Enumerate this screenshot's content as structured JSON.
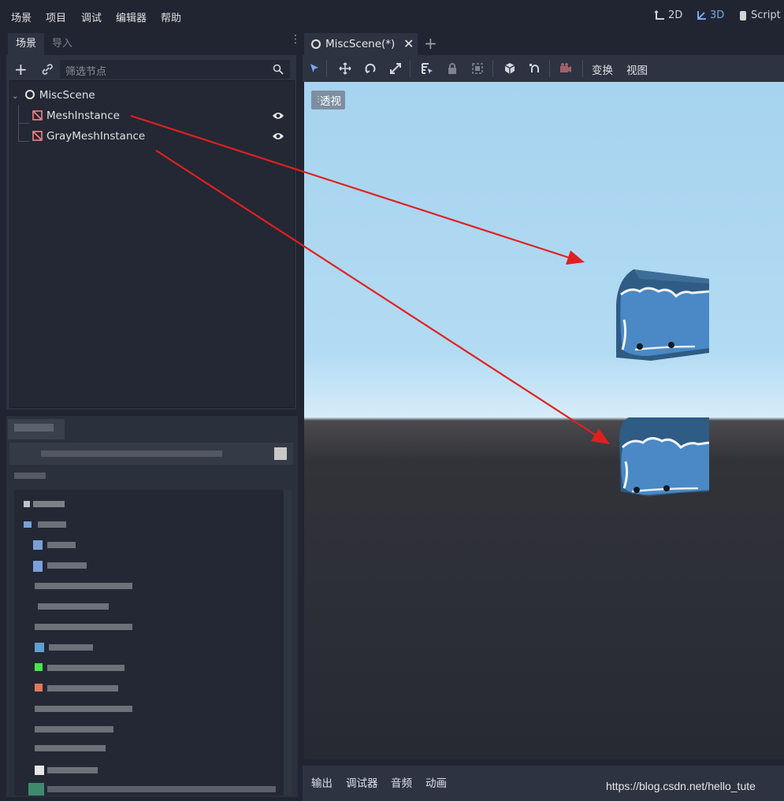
{
  "menu": {
    "items": [
      "场景",
      "项目",
      "调试",
      "编辑器",
      "帮助"
    ]
  },
  "workspaces": {
    "two_d": "2D",
    "three_d": "3D",
    "script": "Script"
  },
  "scene_dock": {
    "tabs": [
      "场景",
      "导入"
    ],
    "filter_placeholder": "筛选节点",
    "tree": {
      "root": "MiscScene",
      "children": [
        "MeshInstance",
        "GrayMeshInstance"
      ]
    }
  },
  "editor_tabs": {
    "active_tab": "MiscScene(*)"
  },
  "viewport_toolbar": {
    "transform_menu": "变换",
    "view_menu": "视图"
  },
  "viewport": {
    "perspective_label": "透视"
  },
  "bottom_panel": {
    "tabs": [
      "输出",
      "调试器",
      "音频",
      "动画"
    ]
  },
  "watermark": "https://blog.csdn.net/hello_tute",
  "colors": {
    "accent": "#78a8f0",
    "arrow": "#e02020",
    "mesh_icon": "#fc7f7f",
    "background": "#202531",
    "panel": "#2d3341"
  }
}
